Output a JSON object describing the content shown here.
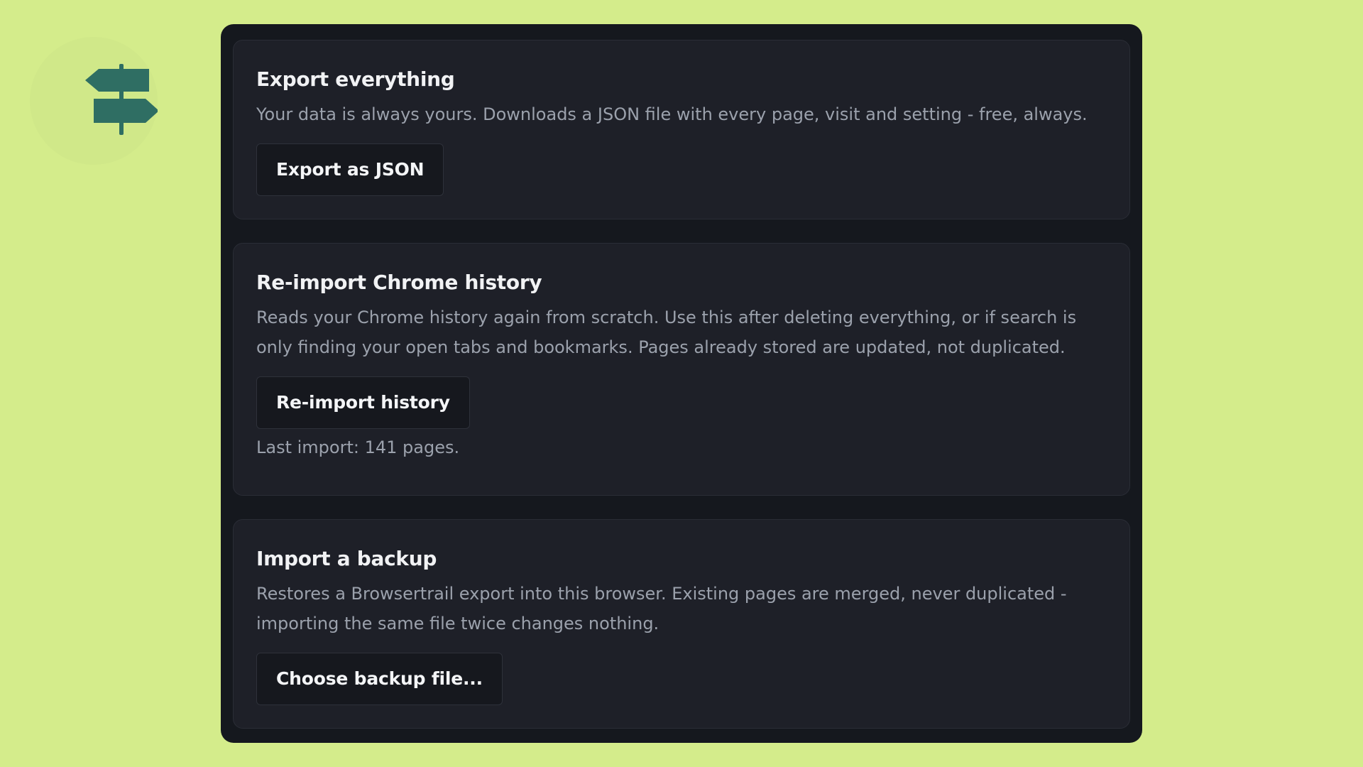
{
  "logo": {
    "icon": "signpost-icon",
    "color": "#2f6e63"
  },
  "sections": {
    "export": {
      "title": "Export everything",
      "description": "Your data is always yours. Downloads a JSON file with every page, visit and setting - free, always.",
      "button_label": "Export as JSON"
    },
    "reimport": {
      "title": "Re-import Chrome history",
      "description": "Reads your Chrome history again from scratch. Use this after deleting everything, or if search is only finding your open tabs and bookmarks. Pages already stored are updated, not duplicated.",
      "button_label": "Re-import history",
      "status": "Last import: 141 pages."
    },
    "backup": {
      "title": "Import a backup",
      "description": "Restores a Browsertrail export into this browser. Existing pages are merged, never duplicated - importing the same file twice changes nothing.",
      "button_label": "Choose backup file..."
    }
  },
  "colors": {
    "background": "#d4ec8b",
    "panel": "#15181e",
    "card": "#1e2028",
    "text": "#f1f2f4",
    "muted_text": "#9ba1ac"
  }
}
